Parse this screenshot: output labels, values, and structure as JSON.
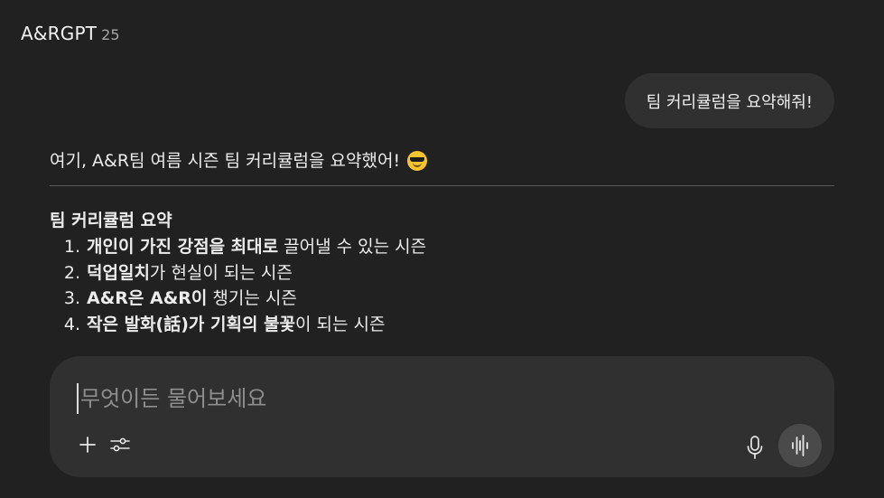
{
  "header": {
    "brand": "A&RGPT",
    "version": "25"
  },
  "conversation": {
    "user_message": "팀 커리큘럼을 요약해줘!",
    "assistant": {
      "intro": "여기, A&R팀 여름 시즌 팀 커리큘럼을 요약했어!",
      "emoji": "smiling-face-with-sunglasses",
      "summary_title": "팀 커리큘럼 요약",
      "items": [
        {
          "num": "1.",
          "bold": "개인이 가진 강점을 최대로",
          "rest": " 끌어낼 수 있는 시즌"
        },
        {
          "num": "2.",
          "bold": "덕업일치",
          "rest": "가 현실이 되는 시즌"
        },
        {
          "num": "3.",
          "bold": "A&R은 A&R이",
          "rest": " 챙기는 시즌"
        },
        {
          "num": "4.",
          "bold": "작은 발화(話)가 기획의 불꽃",
          "rest": "이 되는 시즌"
        }
      ]
    }
  },
  "composer": {
    "placeholder": "무엇이든 물어보세요",
    "value": "",
    "icons": {
      "add": "plus-icon",
      "tools": "sliders-icon",
      "mic": "microphone-icon",
      "voice": "voice-waveform-icon"
    }
  },
  "colors": {
    "background": "#212121",
    "bubble": "#303030",
    "composer": "#303030",
    "voice_button": "#4a4a4a",
    "text": "#ececec",
    "placeholder": "#8e8e8e"
  }
}
